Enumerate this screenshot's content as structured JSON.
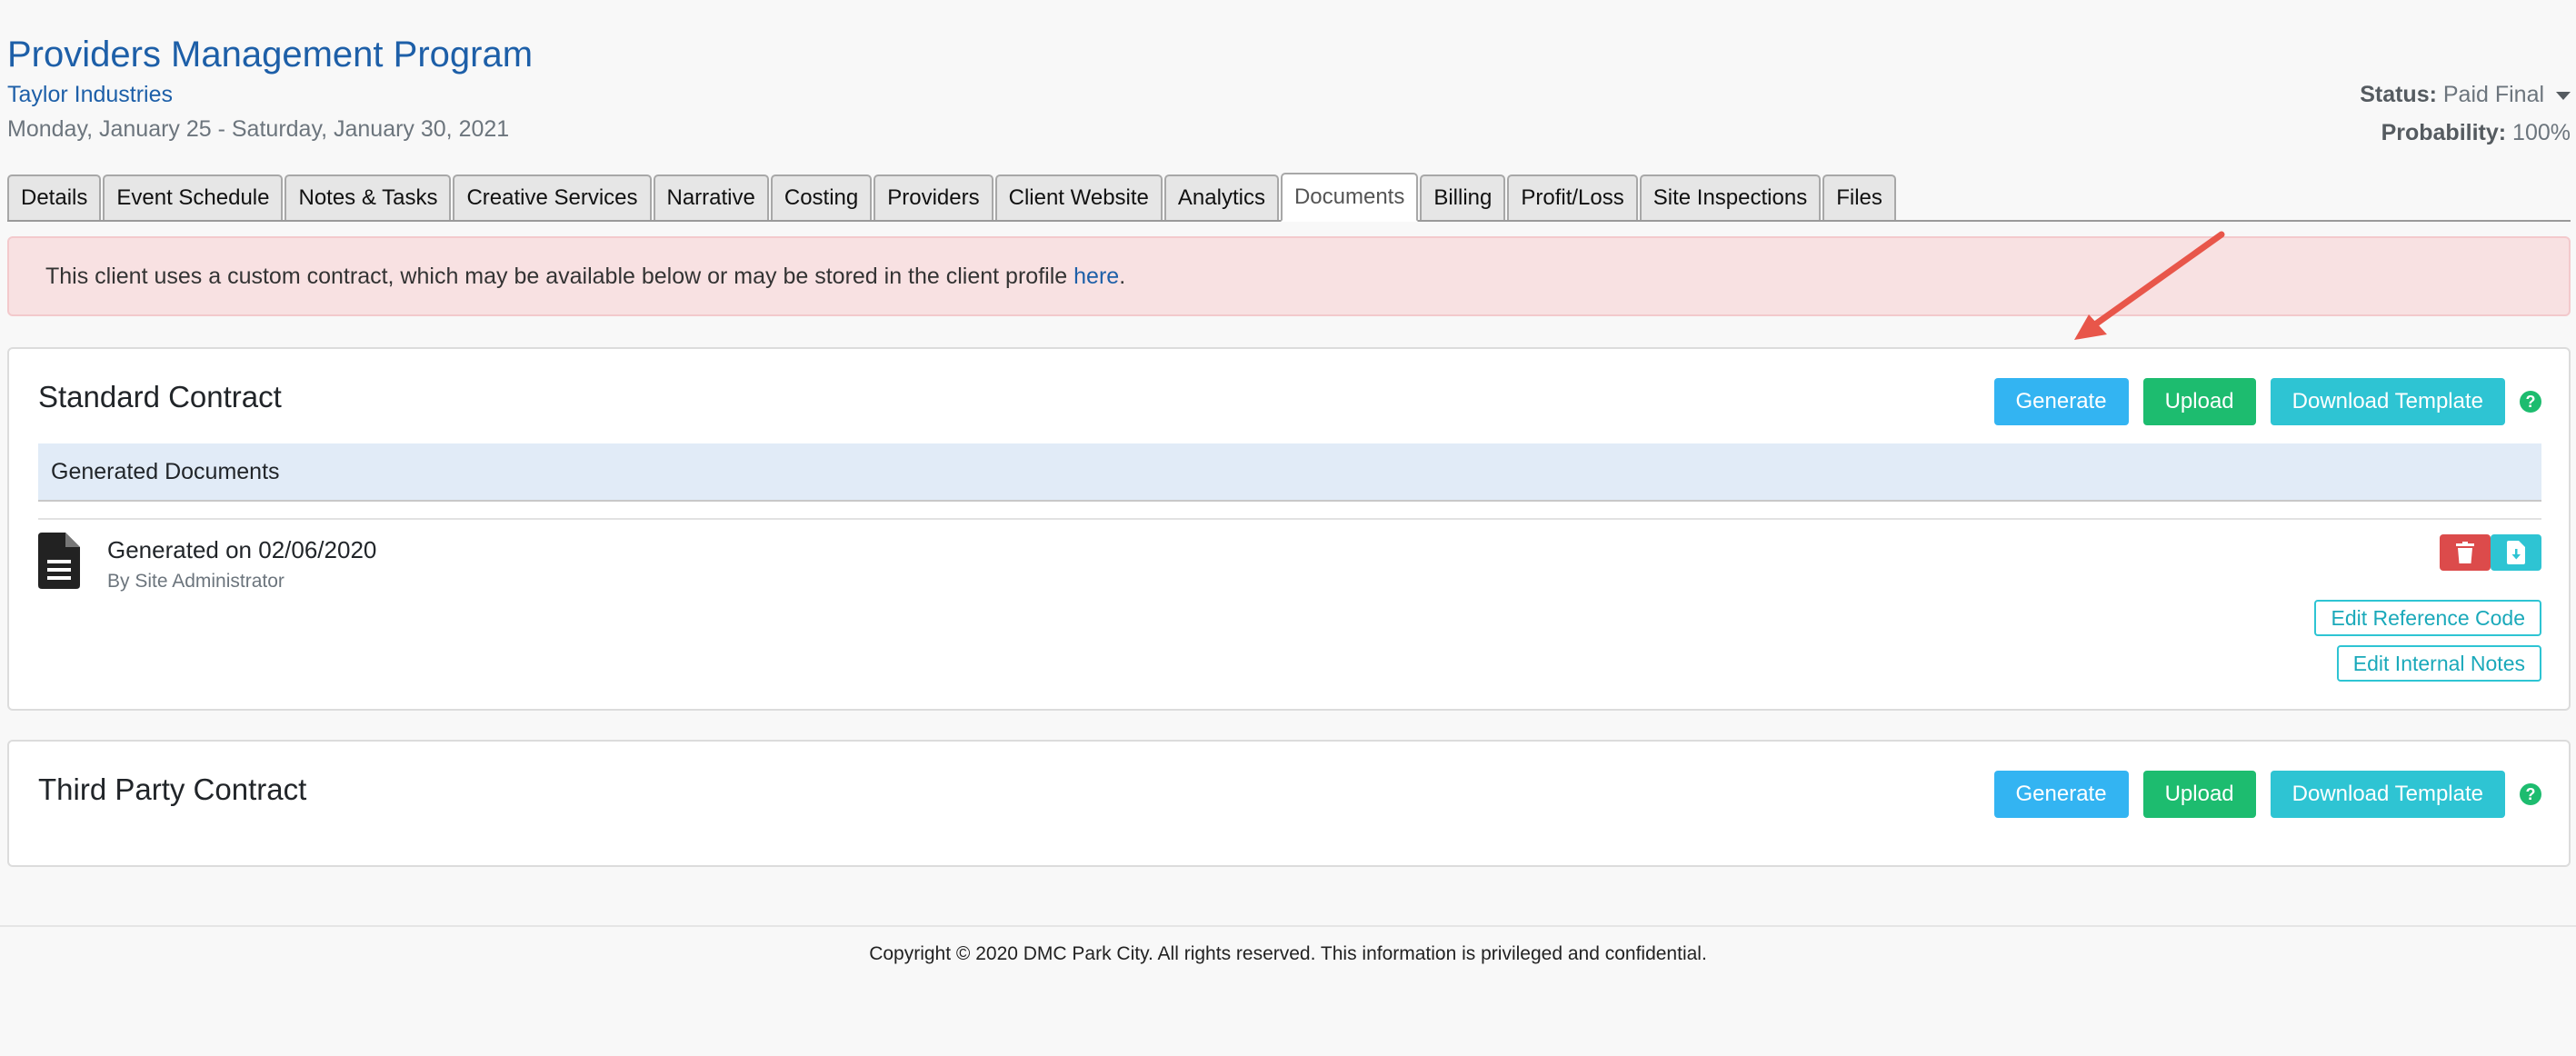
{
  "header": {
    "title": "Providers Management Program",
    "client": "Taylor Industries",
    "date_range": "Monday, January 25 - Saturday, January 30, 2021",
    "status_label": "Status:",
    "status_value": "Paid Final",
    "probability_label": "Probability:",
    "probability_value": "100%"
  },
  "tabs": [
    {
      "label": "Details"
    },
    {
      "label": "Event Schedule"
    },
    {
      "label": "Notes & Tasks"
    },
    {
      "label": "Creative Services"
    },
    {
      "label": "Narrative"
    },
    {
      "label": "Costing"
    },
    {
      "label": "Providers"
    },
    {
      "label": "Client Website"
    },
    {
      "label": "Analytics"
    },
    {
      "label": "Documents",
      "active": true
    },
    {
      "label": "Billing"
    },
    {
      "label": "Profit/Loss"
    },
    {
      "label": "Site Inspections"
    },
    {
      "label": "Files"
    }
  ],
  "alert": {
    "text": "This client uses a custom contract, which may be available below or may be stored in the client profile",
    "link": "here",
    "suffix": "."
  },
  "standard_contract": {
    "title": "Standard Contract",
    "generate": "Generate",
    "upload": "Upload",
    "download_template": "Download Template",
    "help": "?",
    "generated_header": "Generated Documents",
    "doc_title": "Generated on 02/06/2020",
    "doc_author": "By Site Administrator",
    "edit_reference": "Edit Reference Code",
    "edit_notes": "Edit Internal Notes"
  },
  "third_party_contract": {
    "title": "Third Party Contract",
    "generate": "Generate",
    "upload": "Upload",
    "download_template": "Download Template",
    "help": "?"
  },
  "footer": {
    "text": "Copyright © 2020 DMC Park City. All rights reserved. This information is privileged and confidential."
  },
  "icons": {
    "document": "document-icon",
    "delete": "trash-icon",
    "download": "file-download-icon",
    "help": "question-icon",
    "caret": "caret-down-icon",
    "arrow": "annotation-arrow"
  },
  "colors": {
    "brand_blue": "#1d5fa8",
    "generate": "#33b4f2",
    "upload": "#1dbc6f",
    "template": "#2ec4d3",
    "delete": "#dc4b4b",
    "alert_bg": "#f8e1e2",
    "arrow": "#e8564a"
  }
}
